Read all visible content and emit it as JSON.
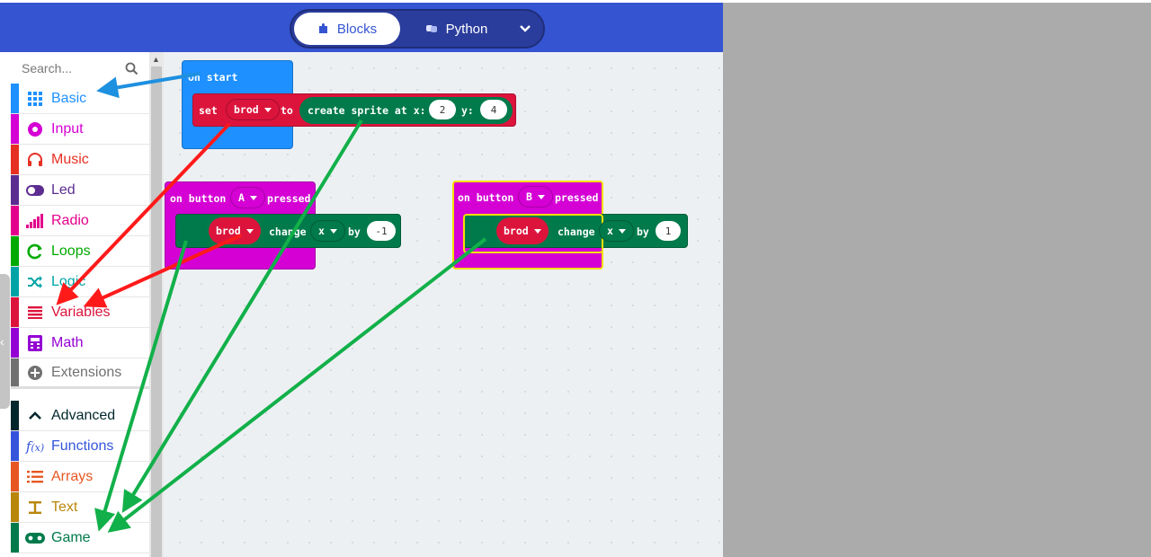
{
  "header": {
    "blocks_label": "Blocks",
    "python_label": "Python"
  },
  "sidebar": {
    "search_placeholder": "Search...",
    "categories": [
      {
        "label": "Basic",
        "color": "#1e90ff",
        "icon": "grid-icon"
      },
      {
        "label": "Input",
        "color": "#d400d4",
        "icon": "target-icon"
      },
      {
        "label": "Music",
        "color": "#e63022",
        "icon": "headphones-icon"
      },
      {
        "label": "Led",
        "color": "#5c2d91",
        "icon": "toggle-icon"
      },
      {
        "label": "Radio",
        "color": "#e3008c",
        "icon": "signal-icon"
      },
      {
        "label": "Loops",
        "color": "#00aa00",
        "icon": "refresh-icon"
      },
      {
        "label": "Logic",
        "color": "#00a4a6",
        "icon": "shuffle-icon"
      },
      {
        "label": "Variables",
        "color": "#dc143c",
        "icon": "list-icon"
      },
      {
        "label": "Math",
        "color": "#9400d3",
        "icon": "calculator-icon"
      },
      {
        "label": "Extensions",
        "color": "#717171",
        "icon": "plus-circle-icon"
      },
      {
        "label": "Advanced",
        "color": "#00272b",
        "icon": "chevron-up-icon"
      },
      {
        "label": "Functions",
        "color": "#3455db",
        "icon": "function-icon"
      },
      {
        "label": "Arrays",
        "color": "#e65722",
        "icon": "bulleted-list-icon"
      },
      {
        "label": "Text",
        "color": "#b8860b",
        "icon": "text-icon"
      },
      {
        "label": "Game",
        "color": "#007a4b",
        "icon": "gamepad-icon"
      }
    ]
  },
  "workspace": {
    "on_start": {
      "label": "on start",
      "set_label": "set",
      "variable": "brod",
      "to_label": "to",
      "create_sprite_label": "create sprite at x:",
      "x_value": "2",
      "y_label": "y:",
      "y_value": "4"
    },
    "button_a": {
      "on_label": "on button",
      "button": "A",
      "pressed_label": "pressed",
      "variable": "brod",
      "change_label": "change",
      "axis": "x",
      "by_label": "by",
      "amount": "-1"
    },
    "button_b": {
      "on_label": "on button",
      "button": "B",
      "pressed_label": "pressed",
      "variable": "brod",
      "change_label": "change",
      "axis": "x",
      "by_label": "by",
      "amount": "1"
    }
  },
  "colors": {
    "header": "#3454d1",
    "basic_block": "#1e90ff",
    "variables_block": "#dc143c",
    "input_block": "#d400d4",
    "game_block": "#007a4b",
    "arrow_blue": "#1e90e0",
    "arrow_red": "#ff1a1a",
    "arrow_green": "#12b04a"
  }
}
